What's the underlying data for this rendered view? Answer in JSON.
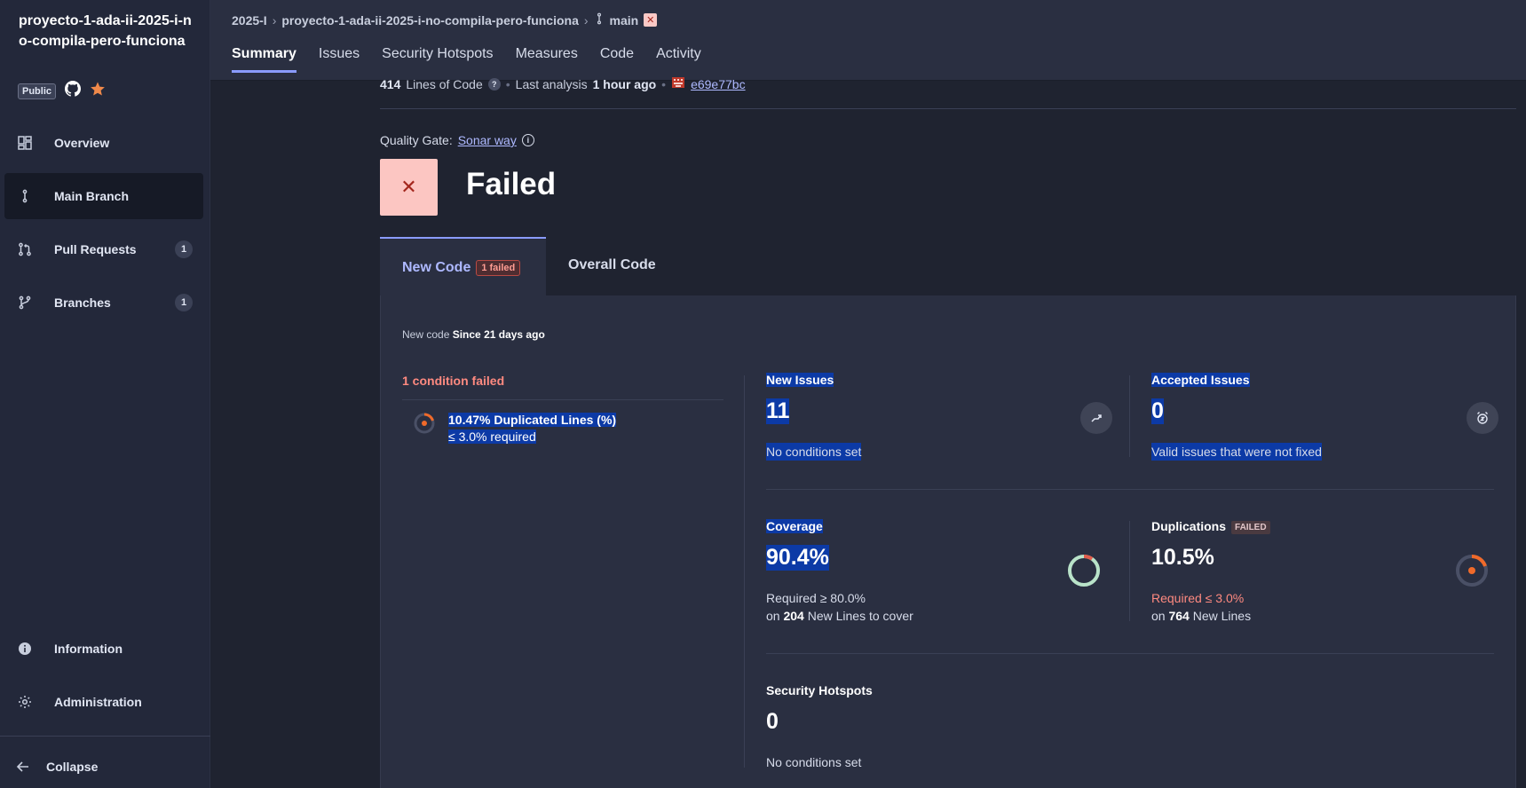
{
  "project": {
    "name": "proyecto-1-ada-ii-2025-i-no-compila-pero-funciona",
    "visibility": "Public"
  },
  "sidebar": {
    "items": [
      {
        "label": "Overview",
        "icon": "overview-grid-icon"
      },
      {
        "label": "Main Branch",
        "icon": "branch-icon"
      },
      {
        "label": "Pull Requests",
        "icon": "pull-request-icon",
        "count": "1"
      },
      {
        "label": "Branches",
        "icon": "branches-icon",
        "count": "1"
      },
      {
        "label": "Information",
        "icon": "info-icon"
      },
      {
        "label": "Administration",
        "icon": "gear-icon"
      }
    ],
    "collapse_label": "Collapse"
  },
  "breadcrumb": {
    "org": "2025-I",
    "project": "proyecto-1-ada-ii-2025-i-no-compila-pero-funciona",
    "branch": "main"
  },
  "tabs": [
    "Summary",
    "Issues",
    "Security Hotspots",
    "Measures",
    "Code",
    "Activity"
  ],
  "meta": {
    "loc_value": "414",
    "loc_label": "Lines of Code",
    "analysis_label": "Last analysis",
    "analysis_time": "1 hour ago",
    "commit": "e69e77bc"
  },
  "quality_gate": {
    "label": "Quality Gate:",
    "name": "Sonar way",
    "status": "Failed",
    "status_icon": "✕"
  },
  "code_tabs": {
    "new": "New Code",
    "new_badge": "1 failed",
    "overall": "Overall Code"
  },
  "new_code": {
    "since_label": "New code",
    "since_value": "Since 21 days ago"
  },
  "conditions": {
    "title": "1 condition failed",
    "item_value": "10.47% Duplicated Lines (%)",
    "item_required": "≤ 3.0% required"
  },
  "metrics": {
    "new_issues": {
      "title": "New Issues",
      "value": "11",
      "sub": "No conditions set"
    },
    "accepted_issues": {
      "title": "Accepted Issues",
      "value": "0",
      "sub": "Valid issues that were not fixed"
    },
    "coverage": {
      "title": "Coverage",
      "value": "90.4%",
      "required": "Required ≥ 80.0%",
      "lines_prefix": "on",
      "lines_count": "204",
      "lines_suffix": "New Lines to cover",
      "fraction": 0.904
    },
    "duplications": {
      "title": "Duplications",
      "badge": "FAILED",
      "value": "10.5%",
      "required": "Required ≤ 3.0%",
      "lines_prefix": "on",
      "lines_count": "764",
      "lines_suffix": "New Lines",
      "fraction": 0.105
    },
    "security_hotspots": {
      "title": "Security Hotspots",
      "value": "0",
      "sub": "No conditions set"
    }
  },
  "colors": {
    "accent": "#8a9bff",
    "failed": "#ff8a80",
    "duplication": "#f06a2a",
    "coverage": "#b9e3c9"
  }
}
